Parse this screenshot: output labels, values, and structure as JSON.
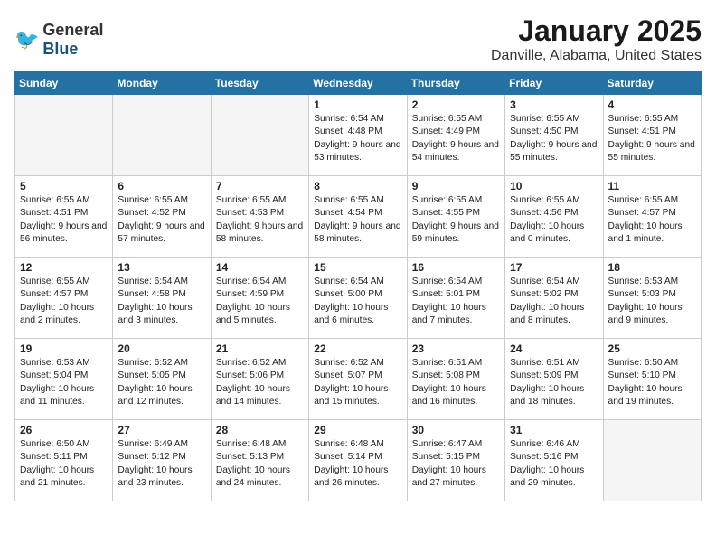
{
  "header": {
    "logo_general": "General",
    "logo_blue": "Blue",
    "month": "January 2025",
    "location": "Danville, Alabama, United States"
  },
  "days_of_week": [
    "Sunday",
    "Monday",
    "Tuesday",
    "Wednesday",
    "Thursday",
    "Friday",
    "Saturday"
  ],
  "weeks": [
    [
      {
        "day": "",
        "empty": true
      },
      {
        "day": "",
        "empty": true
      },
      {
        "day": "",
        "empty": true
      },
      {
        "day": "1",
        "sunrise": "6:54 AM",
        "sunset": "4:48 PM",
        "daylight": "9 hours and 53 minutes."
      },
      {
        "day": "2",
        "sunrise": "6:55 AM",
        "sunset": "4:49 PM",
        "daylight": "9 hours and 54 minutes."
      },
      {
        "day": "3",
        "sunrise": "6:55 AM",
        "sunset": "4:50 PM",
        "daylight": "9 hours and 55 minutes."
      },
      {
        "day": "4",
        "sunrise": "6:55 AM",
        "sunset": "4:51 PM",
        "daylight": "9 hours and 55 minutes."
      }
    ],
    [
      {
        "day": "5",
        "sunrise": "6:55 AM",
        "sunset": "4:51 PM",
        "daylight": "9 hours and 56 minutes."
      },
      {
        "day": "6",
        "sunrise": "6:55 AM",
        "sunset": "4:52 PM",
        "daylight": "9 hours and 57 minutes."
      },
      {
        "day": "7",
        "sunrise": "6:55 AM",
        "sunset": "4:53 PM",
        "daylight": "9 hours and 58 minutes."
      },
      {
        "day": "8",
        "sunrise": "6:55 AM",
        "sunset": "4:54 PM",
        "daylight": "9 hours and 58 minutes."
      },
      {
        "day": "9",
        "sunrise": "6:55 AM",
        "sunset": "4:55 PM",
        "daylight": "9 hours and 59 minutes."
      },
      {
        "day": "10",
        "sunrise": "6:55 AM",
        "sunset": "4:56 PM",
        "daylight": "10 hours and 0 minutes."
      },
      {
        "day": "11",
        "sunrise": "6:55 AM",
        "sunset": "4:57 PM",
        "daylight": "10 hours and 1 minute."
      }
    ],
    [
      {
        "day": "12",
        "sunrise": "6:55 AM",
        "sunset": "4:57 PM",
        "daylight": "10 hours and 2 minutes."
      },
      {
        "day": "13",
        "sunrise": "6:54 AM",
        "sunset": "4:58 PM",
        "daylight": "10 hours and 3 minutes."
      },
      {
        "day": "14",
        "sunrise": "6:54 AM",
        "sunset": "4:59 PM",
        "daylight": "10 hours and 5 minutes."
      },
      {
        "day": "15",
        "sunrise": "6:54 AM",
        "sunset": "5:00 PM",
        "daylight": "10 hours and 6 minutes."
      },
      {
        "day": "16",
        "sunrise": "6:54 AM",
        "sunset": "5:01 PM",
        "daylight": "10 hours and 7 minutes."
      },
      {
        "day": "17",
        "sunrise": "6:54 AM",
        "sunset": "5:02 PM",
        "daylight": "10 hours and 8 minutes."
      },
      {
        "day": "18",
        "sunrise": "6:53 AM",
        "sunset": "5:03 PM",
        "daylight": "10 hours and 9 minutes."
      }
    ],
    [
      {
        "day": "19",
        "sunrise": "6:53 AM",
        "sunset": "5:04 PM",
        "daylight": "10 hours and 11 minutes."
      },
      {
        "day": "20",
        "sunrise": "6:52 AM",
        "sunset": "5:05 PM",
        "daylight": "10 hours and 12 minutes."
      },
      {
        "day": "21",
        "sunrise": "6:52 AM",
        "sunset": "5:06 PM",
        "daylight": "10 hours and 14 minutes."
      },
      {
        "day": "22",
        "sunrise": "6:52 AM",
        "sunset": "5:07 PM",
        "daylight": "10 hours and 15 minutes."
      },
      {
        "day": "23",
        "sunrise": "6:51 AM",
        "sunset": "5:08 PM",
        "daylight": "10 hours and 16 minutes."
      },
      {
        "day": "24",
        "sunrise": "6:51 AM",
        "sunset": "5:09 PM",
        "daylight": "10 hours and 18 minutes."
      },
      {
        "day": "25",
        "sunrise": "6:50 AM",
        "sunset": "5:10 PM",
        "daylight": "10 hours and 19 minutes."
      }
    ],
    [
      {
        "day": "26",
        "sunrise": "6:50 AM",
        "sunset": "5:11 PM",
        "daylight": "10 hours and 21 minutes."
      },
      {
        "day": "27",
        "sunrise": "6:49 AM",
        "sunset": "5:12 PM",
        "daylight": "10 hours and 23 minutes."
      },
      {
        "day": "28",
        "sunrise": "6:48 AM",
        "sunset": "5:13 PM",
        "daylight": "10 hours and 24 minutes."
      },
      {
        "day": "29",
        "sunrise": "6:48 AM",
        "sunset": "5:14 PM",
        "daylight": "10 hours and 26 minutes."
      },
      {
        "day": "30",
        "sunrise": "6:47 AM",
        "sunset": "5:15 PM",
        "daylight": "10 hours and 27 minutes."
      },
      {
        "day": "31",
        "sunrise": "6:46 AM",
        "sunset": "5:16 PM",
        "daylight": "10 hours and 29 minutes."
      },
      {
        "day": "",
        "empty": true
      }
    ]
  ]
}
